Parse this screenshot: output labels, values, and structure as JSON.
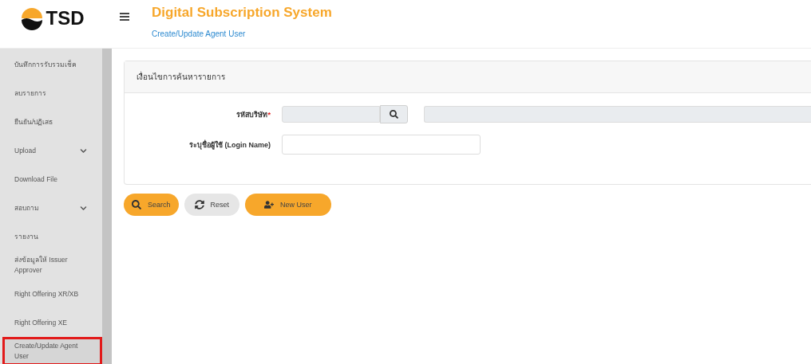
{
  "header": {
    "logo": "TSD",
    "title": "Digital Subscription System",
    "breadcrumb": "Create/Update Agent User"
  },
  "sidebar": {
    "items": [
      {
        "label": "บันทึกการรับรวมเช็ค",
        "expandable": false,
        "selected": false
      },
      {
        "label": "ลบรายการ",
        "expandable": false,
        "selected": false
      },
      {
        "label": "ยืนยัน/ปฏิเสธ",
        "expandable": false,
        "selected": false
      },
      {
        "label": "Upload",
        "expandable": true,
        "selected": false
      },
      {
        "label": "Download File",
        "expandable": false,
        "selected": false
      },
      {
        "label": "สอบถาม",
        "expandable": true,
        "selected": false
      },
      {
        "label": "รายงาน",
        "expandable": false,
        "selected": false
      },
      {
        "label": "ส่งข้อมูลให้ Issuer Approver",
        "expandable": false,
        "selected": false
      },
      {
        "label": "Right Offering XR/XB",
        "expandable": false,
        "selected": false
      },
      {
        "label": "Right Offering XE",
        "expandable": false,
        "selected": false
      },
      {
        "label": "Create/Update Agent User",
        "expandable": false,
        "selected": true
      }
    ]
  },
  "search_panel": {
    "title": "เงื่อนไขการค้นหารายการ",
    "fields": [
      {
        "label": "รหัสบริษัท",
        "required_mark": "*",
        "kind": "lookup"
      },
      {
        "label": "ระบุชื่อผู้ใช้ (Login Name)",
        "kind": "text"
      }
    ]
  },
  "buttons": [
    {
      "label": "Search",
      "kind": "search"
    },
    {
      "label": "Reset",
      "kind": "reset"
    },
    {
      "label": "New User",
      "kind": "new-user"
    }
  ]
}
